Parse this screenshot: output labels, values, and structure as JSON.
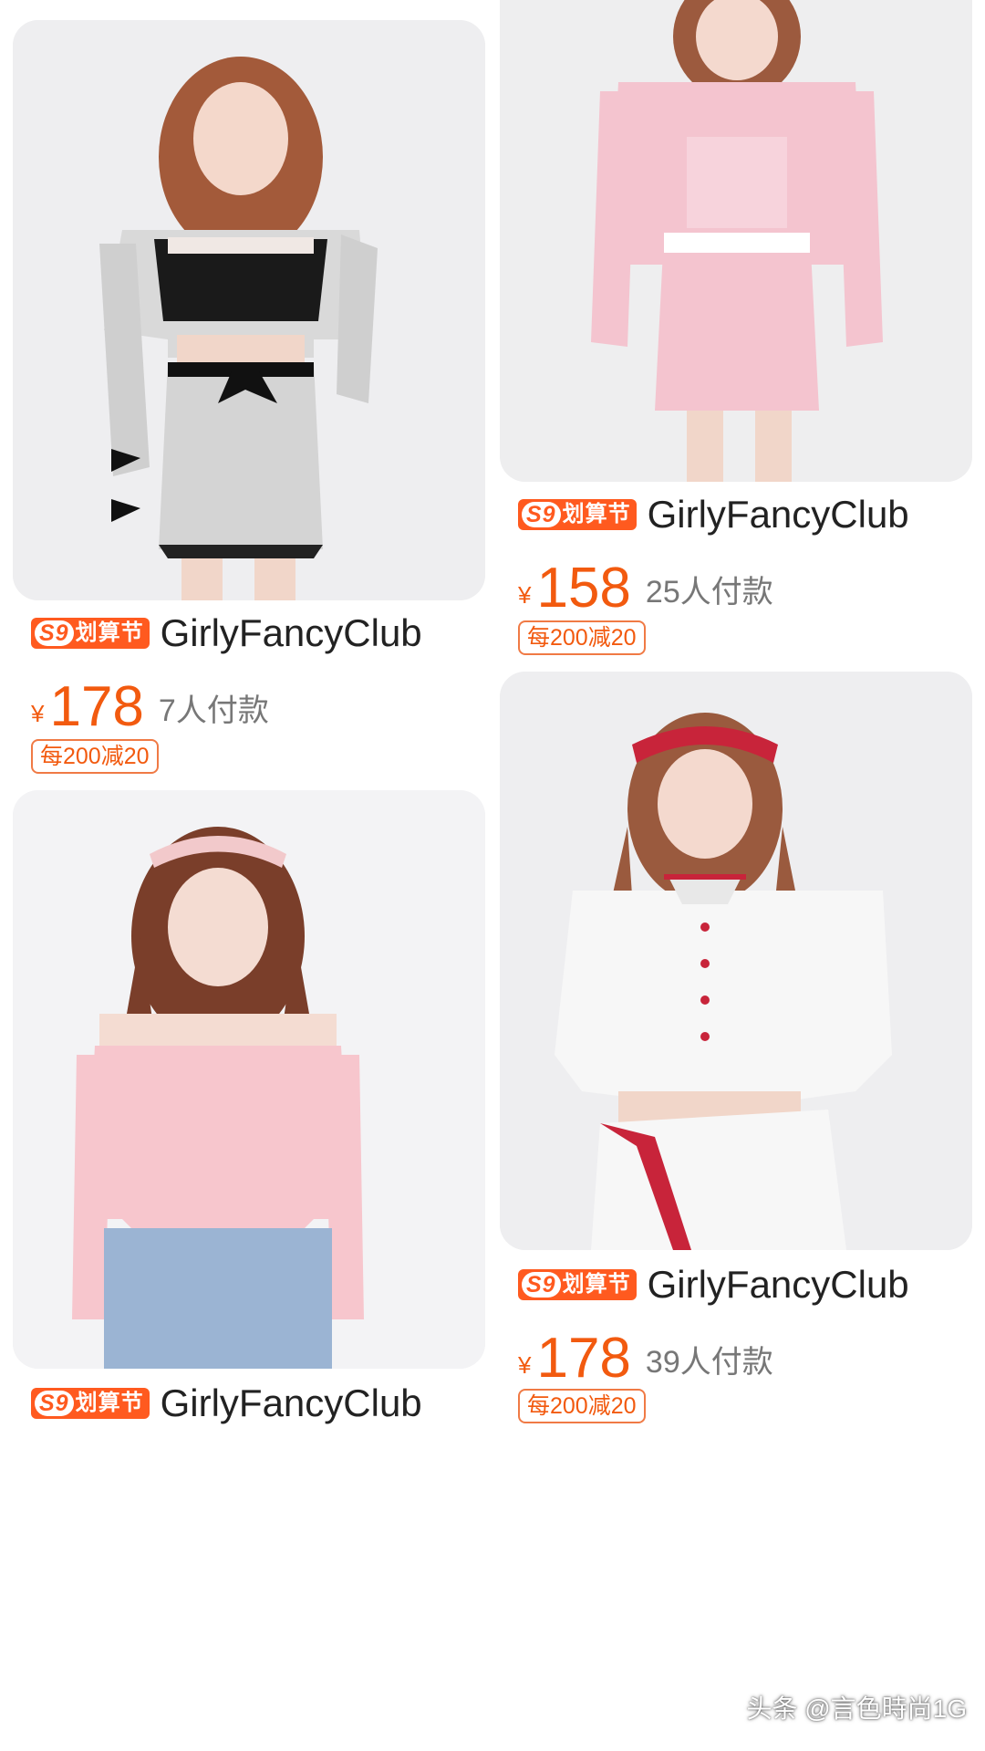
{
  "badge": {
    "mark": "S9",
    "label": "划算节"
  },
  "products": [
    {
      "shop": "GirlyFancyClub",
      "currency": "¥",
      "price": "178",
      "sales": "7人付款",
      "coupon": "每200减20",
      "image_desc": "grey tweed jacket and skirt set with black bows"
    },
    {
      "shop": "GirlyFancyClub",
      "currency": "¥",
      "price": "158",
      "sales": "25人付款",
      "coupon": "每200减20",
      "image_desc": "pink gingham jacket, top and skirt set"
    },
    {
      "shop": "GirlyFancyClub",
      "currency": "¥",
      "price": "",
      "sales": "",
      "coupon": "",
      "image_desc": "pink fuzzy halter off-shoulder sweater with jeans"
    },
    {
      "shop": "GirlyFancyClub",
      "currency": "¥",
      "price": "178",
      "sales": "39人付款",
      "coupon": "每200减20",
      "image_desc": "white cropped shirt with red trim and pleated skirt"
    }
  ],
  "watermark": "头条 @言色時尚1G",
  "colors": {
    "accent": "#f25a0f",
    "badge_bg": "#ff5a1f",
    "photo_bg": "#eeeeef"
  }
}
